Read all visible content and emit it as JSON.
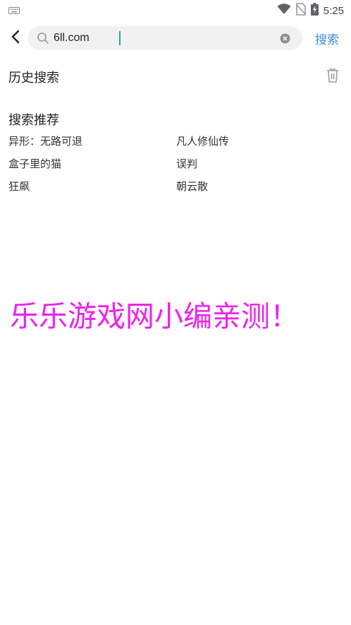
{
  "status_bar": {
    "time": "5:25",
    "icons": [
      "keyboard-icon",
      "wifi-icon",
      "no-sim-icon",
      "battery-charging-icon"
    ]
  },
  "header": {
    "back_icon": "back-arrow-icon",
    "search_value": "6ll.com",
    "search_icon": "search-icon",
    "clear_icon": "clear-icon",
    "search_button_label": "搜索"
  },
  "history": {
    "title": "历史搜索",
    "delete_icon": "trash-icon"
  },
  "recommend": {
    "title": "搜索推荐",
    "items": [
      "异形：无路可退",
      "凡人修仙传",
      "盒子里的猫",
      "误判",
      "狂飙",
      "朝云散"
    ]
  },
  "watermark": {
    "text": "乐乐游戏网小编亲测！",
    "color": "#ee22ee"
  },
  "colors": {
    "accent": "#3a8ee6",
    "caret": "#19b393",
    "search_bg": "#f1f1f1"
  }
}
